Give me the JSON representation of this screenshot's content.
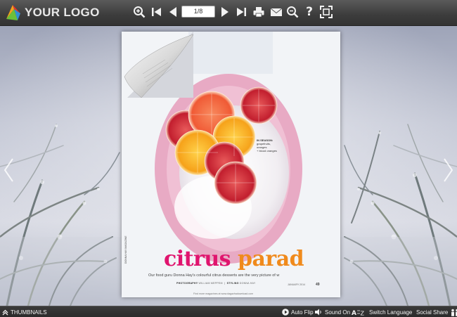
{
  "toolbar": {
    "logo_text": "YOUR LOGO",
    "page_indicator": "1/8",
    "tools": [
      "zoom-in-icon",
      "first-page-icon",
      "previous-page-icon",
      "next-page-icon",
      "last-page-icon",
      "print-icon",
      "email-icon",
      "search-icon",
      "help-icon",
      "fullscreen-icon"
    ],
    "help_glyph": "?"
  },
  "page": {
    "headline_word1": "citrus",
    "headline_word2": "parad",
    "standfirst": "Our food guru Donna Hay's colourful citrus desserts are the very picture of w",
    "credits_label1": "PHOTOGRAPHY",
    "credits_text1": "WILLIAM MEPPEM",
    "credits_label2": "STYLING",
    "credits_text2": "DONNA HAY",
    "season_label": "IN SEASON:",
    "season_line1": "grapefruits, oranges",
    "season_line2": "+ blood oranges",
    "footer_note": "Find more magazines at  www.dagazhadownload.com",
    "month_line": "JANUARY 2014",
    "page_number": "49",
    "side_credit": "DONNA HAY MAGAZINE"
  },
  "bottombar": {
    "thumbnails_label": "THUMBNAILS",
    "auto_flip_label": "Auto Flip",
    "sound_label": "Sound On",
    "switch_language_label": "Switch Language",
    "social_share_label": "Social Share"
  },
  "colors": {
    "toolbar_bg": "#3c3c3c",
    "headline_pink": "#e0146e",
    "headline_orange": "#f08a1c",
    "plate": "#e8aac4"
  }
}
